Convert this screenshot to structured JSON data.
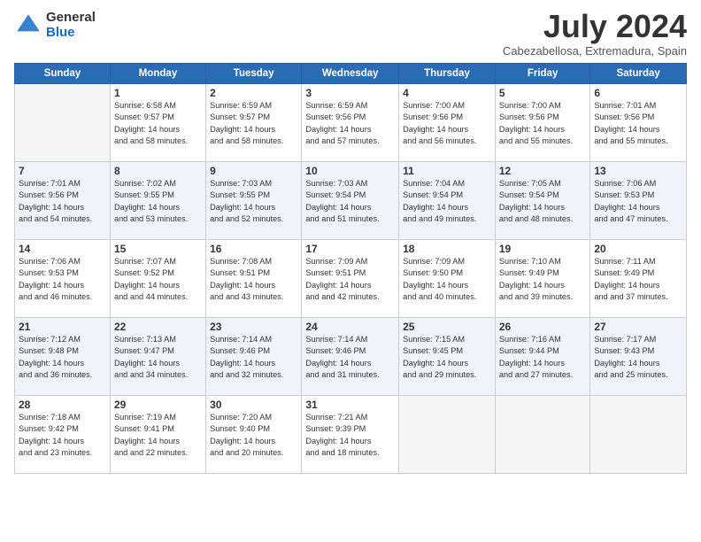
{
  "logo": {
    "general": "General",
    "blue": "Blue"
  },
  "title": "July 2024",
  "subtitle": "Cabezabellosa, Extremadura, Spain",
  "days_of_week": [
    "Sunday",
    "Monday",
    "Tuesday",
    "Wednesday",
    "Thursday",
    "Friday",
    "Saturday"
  ],
  "weeks": [
    [
      {
        "day": "",
        "sunrise": "",
        "sunset": "",
        "daylight": ""
      },
      {
        "day": "1",
        "sunrise": "Sunrise: 6:58 AM",
        "sunset": "Sunset: 9:57 PM",
        "daylight": "Daylight: 14 hours and 58 minutes."
      },
      {
        "day": "2",
        "sunrise": "Sunrise: 6:59 AM",
        "sunset": "Sunset: 9:57 PM",
        "daylight": "Daylight: 14 hours and 58 minutes."
      },
      {
        "day": "3",
        "sunrise": "Sunrise: 6:59 AM",
        "sunset": "Sunset: 9:56 PM",
        "daylight": "Daylight: 14 hours and 57 minutes."
      },
      {
        "day": "4",
        "sunrise": "Sunrise: 7:00 AM",
        "sunset": "Sunset: 9:56 PM",
        "daylight": "Daylight: 14 hours and 56 minutes."
      },
      {
        "day": "5",
        "sunrise": "Sunrise: 7:00 AM",
        "sunset": "Sunset: 9:56 PM",
        "daylight": "Daylight: 14 hours and 55 minutes."
      },
      {
        "day": "6",
        "sunrise": "Sunrise: 7:01 AM",
        "sunset": "Sunset: 9:56 PM",
        "daylight": "Daylight: 14 hours and 55 minutes."
      }
    ],
    [
      {
        "day": "7",
        "sunrise": "Sunrise: 7:01 AM",
        "sunset": "Sunset: 9:56 PM",
        "daylight": "Daylight: 14 hours and 54 minutes."
      },
      {
        "day": "8",
        "sunrise": "Sunrise: 7:02 AM",
        "sunset": "Sunset: 9:55 PM",
        "daylight": "Daylight: 14 hours and 53 minutes."
      },
      {
        "day": "9",
        "sunrise": "Sunrise: 7:03 AM",
        "sunset": "Sunset: 9:55 PM",
        "daylight": "Daylight: 14 hours and 52 minutes."
      },
      {
        "day": "10",
        "sunrise": "Sunrise: 7:03 AM",
        "sunset": "Sunset: 9:54 PM",
        "daylight": "Daylight: 14 hours and 51 minutes."
      },
      {
        "day": "11",
        "sunrise": "Sunrise: 7:04 AM",
        "sunset": "Sunset: 9:54 PM",
        "daylight": "Daylight: 14 hours and 49 minutes."
      },
      {
        "day": "12",
        "sunrise": "Sunrise: 7:05 AM",
        "sunset": "Sunset: 9:54 PM",
        "daylight": "Daylight: 14 hours and 48 minutes."
      },
      {
        "day": "13",
        "sunrise": "Sunrise: 7:06 AM",
        "sunset": "Sunset: 9:53 PM",
        "daylight": "Daylight: 14 hours and 47 minutes."
      }
    ],
    [
      {
        "day": "14",
        "sunrise": "Sunrise: 7:06 AM",
        "sunset": "Sunset: 9:53 PM",
        "daylight": "Daylight: 14 hours and 46 minutes."
      },
      {
        "day": "15",
        "sunrise": "Sunrise: 7:07 AM",
        "sunset": "Sunset: 9:52 PM",
        "daylight": "Daylight: 14 hours and 44 minutes."
      },
      {
        "day": "16",
        "sunrise": "Sunrise: 7:08 AM",
        "sunset": "Sunset: 9:51 PM",
        "daylight": "Daylight: 14 hours and 43 minutes."
      },
      {
        "day": "17",
        "sunrise": "Sunrise: 7:09 AM",
        "sunset": "Sunset: 9:51 PM",
        "daylight": "Daylight: 14 hours and 42 minutes."
      },
      {
        "day": "18",
        "sunrise": "Sunrise: 7:09 AM",
        "sunset": "Sunset: 9:50 PM",
        "daylight": "Daylight: 14 hours and 40 minutes."
      },
      {
        "day": "19",
        "sunrise": "Sunrise: 7:10 AM",
        "sunset": "Sunset: 9:49 PM",
        "daylight": "Daylight: 14 hours and 39 minutes."
      },
      {
        "day": "20",
        "sunrise": "Sunrise: 7:11 AM",
        "sunset": "Sunset: 9:49 PM",
        "daylight": "Daylight: 14 hours and 37 minutes."
      }
    ],
    [
      {
        "day": "21",
        "sunrise": "Sunrise: 7:12 AM",
        "sunset": "Sunset: 9:48 PM",
        "daylight": "Daylight: 14 hours and 36 minutes."
      },
      {
        "day": "22",
        "sunrise": "Sunrise: 7:13 AM",
        "sunset": "Sunset: 9:47 PM",
        "daylight": "Daylight: 14 hours and 34 minutes."
      },
      {
        "day": "23",
        "sunrise": "Sunrise: 7:14 AM",
        "sunset": "Sunset: 9:46 PM",
        "daylight": "Daylight: 14 hours and 32 minutes."
      },
      {
        "day": "24",
        "sunrise": "Sunrise: 7:14 AM",
        "sunset": "Sunset: 9:46 PM",
        "daylight": "Daylight: 14 hours and 31 minutes."
      },
      {
        "day": "25",
        "sunrise": "Sunrise: 7:15 AM",
        "sunset": "Sunset: 9:45 PM",
        "daylight": "Daylight: 14 hours and 29 minutes."
      },
      {
        "day": "26",
        "sunrise": "Sunrise: 7:16 AM",
        "sunset": "Sunset: 9:44 PM",
        "daylight": "Daylight: 14 hours and 27 minutes."
      },
      {
        "day": "27",
        "sunrise": "Sunrise: 7:17 AM",
        "sunset": "Sunset: 9:43 PM",
        "daylight": "Daylight: 14 hours and 25 minutes."
      }
    ],
    [
      {
        "day": "28",
        "sunrise": "Sunrise: 7:18 AM",
        "sunset": "Sunset: 9:42 PM",
        "daylight": "Daylight: 14 hours and 23 minutes."
      },
      {
        "day": "29",
        "sunrise": "Sunrise: 7:19 AM",
        "sunset": "Sunset: 9:41 PM",
        "daylight": "Daylight: 14 hours and 22 minutes."
      },
      {
        "day": "30",
        "sunrise": "Sunrise: 7:20 AM",
        "sunset": "Sunset: 9:40 PM",
        "daylight": "Daylight: 14 hours and 20 minutes."
      },
      {
        "day": "31",
        "sunrise": "Sunrise: 7:21 AM",
        "sunset": "Sunset: 9:39 PM",
        "daylight": "Daylight: 14 hours and 18 minutes."
      },
      {
        "day": "",
        "sunrise": "",
        "sunset": "",
        "daylight": ""
      },
      {
        "day": "",
        "sunrise": "",
        "sunset": "",
        "daylight": ""
      },
      {
        "day": "",
        "sunrise": "",
        "sunset": "",
        "daylight": ""
      }
    ]
  ]
}
